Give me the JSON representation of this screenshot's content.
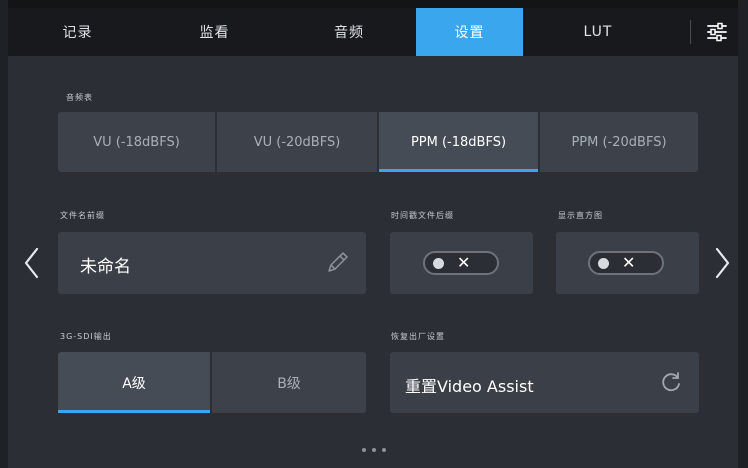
{
  "tabs": [
    {
      "label": "记录",
      "active": false
    },
    {
      "label": "监看",
      "active": false
    },
    {
      "label": "音频",
      "active": false
    },
    {
      "label": "设置",
      "active": true
    },
    {
      "label": "LUT",
      "active": false
    }
  ],
  "colors": {
    "accent": "#3aa6ee",
    "background": "#2b2f35",
    "card": "#3b4048"
  },
  "audio_meter": {
    "label": "音频表",
    "options": [
      "VU (-18dBFS)",
      "VU (-20dBFS)",
      "PPM (-18dBFS)",
      "PPM (-20dBFS)"
    ],
    "selected": "PPM (-18dBFS)"
  },
  "filename_prefix": {
    "label": "文件名前缀",
    "value": "未命名",
    "icon": "edit-pencil-icon"
  },
  "timestamp_suffix": {
    "label": "时间戳文件后缀",
    "state": "off"
  },
  "histogram": {
    "label": "显示直方图",
    "state": "off"
  },
  "sdi_output": {
    "label": "3G-SDI输出",
    "options": [
      "A级",
      "B级"
    ],
    "selected": "A级"
  },
  "factory_reset": {
    "label": "恢复出厂设置",
    "button": "重置Video Assist",
    "icon": "reset-icon"
  },
  "pagination": {
    "pages": 3
  }
}
